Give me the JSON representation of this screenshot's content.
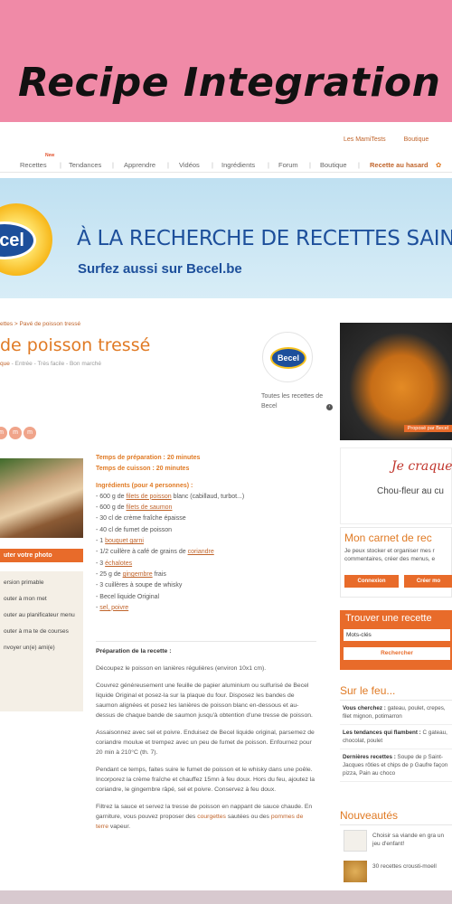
{
  "banner": {
    "title": "Recipe Integration"
  },
  "top_links": [
    "Les MamiTests",
    "Boutique"
  ],
  "nav": {
    "new_badge": "New",
    "items": [
      "Recettes",
      "Tendances",
      "Apprendre",
      "Vidéos",
      "Ingrédients",
      "Forum",
      "Boutique"
    ],
    "random": "Recette au hasard"
  },
  "ad": {
    "logo": "cel",
    "headline": "À LA RECHERCHE DE RECETTES SAINES ET DÉLIC",
    "sub": "Surfez aussi sur Becel.be"
  },
  "recipe": {
    "breadcrumb": "ettes > Pavé de poisson tressé",
    "title": "de poisson tressé",
    "tags_cat": "que",
    "tags": " - Entrée - Très facile - Bon marché",
    "badge": "Becel",
    "all_becel": "Toutes les recettes de Becel",
    "prep_time": "Temps de préparation : 20 minutes",
    "cook_time": "Temps de cuisson : 20 minutes",
    "ingredients_title": "Ingrédients (pour 4 personnes) :",
    "ingredients": [
      {
        "pre": "- 600 g de ",
        "link": "filets de poisson",
        "post": " blanc (cabillaud, turbot...)"
      },
      {
        "pre": "- 600 g de ",
        "link": "filets de saumon",
        "post": ""
      },
      {
        "pre": "- 30 cl de crème fraîche épaisse",
        "link": "",
        "post": ""
      },
      {
        "pre": "- 40 cl de fumet de poisson",
        "link": "",
        "post": ""
      },
      {
        "pre": "- 1 ",
        "link": "bouquet garni",
        "post": ""
      },
      {
        "pre": "- 1/2 cuillère à café de grains de ",
        "link": "coriandre",
        "post": ""
      },
      {
        "pre": "- 3 ",
        "link": "échalotes",
        "post": ""
      },
      {
        "pre": "- 25 g de ",
        "link": "gingembre",
        "post": " frais"
      },
      {
        "pre": "- 3 cuillères à soupe de whisky",
        "link": "",
        "post": ""
      },
      {
        "pre": "- Becel liquide Original",
        "link": "",
        "post": ""
      },
      {
        "pre": "- ",
        "link": "sel, poivre",
        "post": ""
      }
    ],
    "prep_title": "Préparation de la recette :",
    "steps": [
      "Découpez le poisson en lanières régulières (environ 10x1 cm).",
      "Couvrez généreusement une feuille de papier aluminium ou sulfurisé de Becel liquide Original et posez-la sur la plaque du four. Disposez les bandes de saumon alignées et posez les lanières de poisson blanc en-dessous et au-dessus de chaque bande de saumon jusqu'à obtention d'une tresse de poisson.",
      "Assaisonnez avec sel et poivre. Enduisez de Becel liquide original, parsemez de coriandre moulue et trempez avec un peu de fumet de poisson. Enfournez pour 20 min à 210°C (th. 7).",
      "Pendant ce temps, faites suire le fumet de poisson et le whisky dans une poêle. Incorporez la crème fraîche et chauffez 15mn à feu doux. Hors du feu, ajoutez la coriandre, le gingembre râpé, sel et poivre. Conservez à feu doux."
    ],
    "last_step_pre": "Filtrez la sauce et servez la tresse de poisson en nappant de sauce chaude. En garniture, vous pouvez proposer des ",
    "last_step_link1": "courgettes",
    "last_step_mid": " sautées ou des ",
    "last_step_link2": "pommes de terre",
    "last_step_post": " vapeur."
  },
  "left_col": {
    "dots": [
      "m",
      "m",
      "m"
    ],
    "photo_button": "uter votre photo",
    "actions": [
      "ersion primable",
      "outer à mon rnet",
      "outer au planificateur menu",
      "outer à ma te de courses",
      "nvoyer un(e) ami(e)"
    ]
  },
  "sidebar": {
    "photo_caption": "Proposé par Becel",
    "craque": "Je craque",
    "craque_dish": "Chou-fleur au cu",
    "carnet_title": "Mon carnet de rec",
    "carnet_text": "Je peux stocker et organiser mes r commentaires, créer des menus, e",
    "connexion": "Connexion",
    "creer": "Créer mo",
    "find_title": "Trouver une recette",
    "keywords": "Mots-clés",
    "search": "Rechercher",
    "feu_title": "Sur le feu...",
    "vous_label": "Vous cherchez :",
    "vous_text": " gateau, poulet, crepes, filet mignon, potimarron",
    "tend_label": "Les tendances qui flambent :",
    "tend_text": " C gateau, chocolat, poulet",
    "dern_label": "Dernières recettes :",
    "dern_text": " Soupe de p Saint-Jacques rôties et chips de p Gaufre façon pizza, Pain au choco",
    "nouv_title": "Nouveautés",
    "nouv_items": [
      "Choisir sa viande en gra un jeu d'enfant!",
      "30 recettes crousti-moell"
    ]
  }
}
